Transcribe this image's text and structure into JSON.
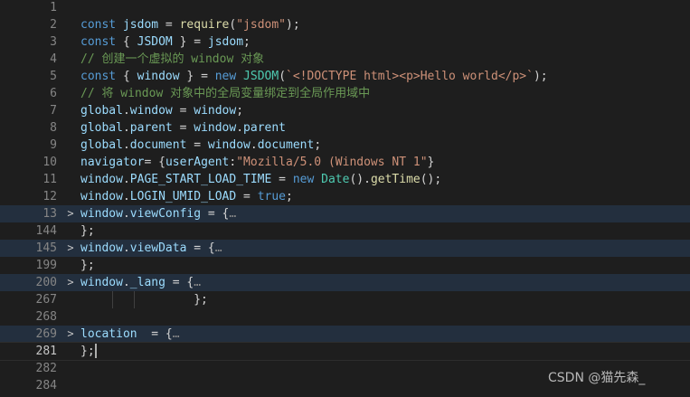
{
  "editor": {
    "lines": [
      {
        "num": "1",
        "fold": "",
        "code": []
      },
      {
        "num": "2",
        "fold": "",
        "code": [
          {
            "t": "const ",
            "c": "kw"
          },
          {
            "t": "jsdom",
            "c": "var"
          },
          {
            "t": " = ",
            "c": "op"
          },
          {
            "t": "require",
            "c": "fn"
          },
          {
            "t": "(",
            "c": "op"
          },
          {
            "t": "\"jsdom\"",
            "c": "str"
          },
          {
            "t": ");",
            "c": "op"
          }
        ]
      },
      {
        "num": "3",
        "fold": "",
        "code": [
          {
            "t": "const ",
            "c": "kw"
          },
          {
            "t": "{ ",
            "c": "op"
          },
          {
            "t": "JSDOM",
            "c": "var"
          },
          {
            "t": " } = ",
            "c": "op"
          },
          {
            "t": "jsdom",
            "c": "var"
          },
          {
            "t": ";",
            "c": "op"
          }
        ]
      },
      {
        "num": "4",
        "fold": "",
        "code": [
          {
            "t": "// 创建一个虚拟的 window 对象",
            "c": "cmt"
          }
        ]
      },
      {
        "num": "5",
        "fold": "",
        "code": [
          {
            "t": "const ",
            "c": "kw"
          },
          {
            "t": "{ ",
            "c": "op"
          },
          {
            "t": "window",
            "c": "var"
          },
          {
            "t": " } = ",
            "c": "op"
          },
          {
            "t": "new ",
            "c": "kw"
          },
          {
            "t": "JSDOM",
            "c": "cls"
          },
          {
            "t": "(",
            "c": "op"
          },
          {
            "t": "`<!DOCTYPE html><p>Hello world</p>`",
            "c": "str"
          },
          {
            "t": ");",
            "c": "op"
          }
        ]
      },
      {
        "num": "6",
        "fold": "",
        "code": [
          {
            "t": "// 将 window 对象中的全局变量绑定到全局作用域中",
            "c": "cmt"
          }
        ]
      },
      {
        "num": "7",
        "fold": "",
        "code": [
          {
            "t": "global",
            "c": "var"
          },
          {
            "t": ".",
            "c": "op"
          },
          {
            "t": "window",
            "c": "var"
          },
          {
            "t": " = ",
            "c": "op"
          },
          {
            "t": "window",
            "c": "var"
          },
          {
            "t": ";",
            "c": "op"
          }
        ]
      },
      {
        "num": "8",
        "fold": "",
        "code": [
          {
            "t": "global",
            "c": "var"
          },
          {
            "t": ".",
            "c": "op"
          },
          {
            "t": "parent",
            "c": "var"
          },
          {
            "t": " = ",
            "c": "op"
          },
          {
            "t": "window",
            "c": "var"
          },
          {
            "t": ".",
            "c": "op"
          },
          {
            "t": "parent",
            "c": "var"
          }
        ]
      },
      {
        "num": "9",
        "fold": "",
        "code": [
          {
            "t": "global",
            "c": "var"
          },
          {
            "t": ".",
            "c": "op"
          },
          {
            "t": "document",
            "c": "var"
          },
          {
            "t": " = ",
            "c": "op"
          },
          {
            "t": "window",
            "c": "var"
          },
          {
            "t": ".",
            "c": "op"
          },
          {
            "t": "document",
            "c": "var"
          },
          {
            "t": ";",
            "c": "op"
          }
        ]
      },
      {
        "num": "10",
        "fold": "",
        "code": [
          {
            "t": "navigator",
            "c": "var"
          },
          {
            "t": "= {",
            "c": "op"
          },
          {
            "t": "userAgent",
            "c": "var"
          },
          {
            "t": ":",
            "c": "op"
          },
          {
            "t": "\"Mozilla/5.0 (Windows NT 1\"",
            "c": "str"
          },
          {
            "t": "}",
            "c": "op"
          }
        ]
      },
      {
        "num": "11",
        "fold": "",
        "code": [
          {
            "t": "window",
            "c": "var"
          },
          {
            "t": ".",
            "c": "op"
          },
          {
            "t": "PAGE_START_LOAD_TIME",
            "c": "var"
          },
          {
            "t": " = ",
            "c": "op"
          },
          {
            "t": "new ",
            "c": "kw"
          },
          {
            "t": "Date",
            "c": "cls"
          },
          {
            "t": "().",
            "c": "op"
          },
          {
            "t": "getTime",
            "c": "fn"
          },
          {
            "t": "();",
            "c": "op"
          }
        ]
      },
      {
        "num": "12",
        "fold": "",
        "code": [
          {
            "t": "window",
            "c": "var"
          },
          {
            "t": ".",
            "c": "op"
          },
          {
            "t": "LOGIN_UMID_LOAD",
            "c": "var"
          },
          {
            "t": " = ",
            "c": "op"
          },
          {
            "t": "true",
            "c": "kw"
          },
          {
            "t": ";",
            "c": "op"
          }
        ]
      },
      {
        "num": "13",
        "fold": ">",
        "folded": true,
        "code": [
          {
            "t": "window",
            "c": "var"
          },
          {
            "t": ".",
            "c": "op"
          },
          {
            "t": "viewConfig",
            "c": "var"
          },
          {
            "t": " = {",
            "c": "op"
          },
          {
            "t": "…",
            "c": "ellipsis"
          }
        ]
      },
      {
        "num": "144",
        "fold": "",
        "code": [
          {
            "t": "};",
            "c": "op"
          }
        ]
      },
      {
        "num": "145",
        "fold": ">",
        "folded": true,
        "code": [
          {
            "t": "window",
            "c": "var"
          },
          {
            "t": ".",
            "c": "op"
          },
          {
            "t": "viewData",
            "c": "var"
          },
          {
            "t": " = {",
            "c": "op"
          },
          {
            "t": "…",
            "c": "ellipsis"
          }
        ]
      },
      {
        "num": "199",
        "fold": "",
        "code": [
          {
            "t": "};",
            "c": "op"
          }
        ]
      },
      {
        "num": "200",
        "fold": ">",
        "folded": true,
        "code": [
          {
            "t": "window",
            "c": "var"
          },
          {
            "t": ".",
            "c": "op"
          },
          {
            "t": "_lang",
            "c": "var"
          },
          {
            "t": " = {",
            "c": "op"
          },
          {
            "t": "…",
            "c": "ellipsis"
          }
        ]
      },
      {
        "num": "267",
        "fold": "",
        "guides": true,
        "code": [
          {
            "t": "                };",
            "c": "op"
          }
        ]
      },
      {
        "num": "268",
        "fold": "",
        "code": []
      },
      {
        "num": "269",
        "fold": ">",
        "folded": true,
        "code": [
          {
            "t": "location",
            "c": "var"
          },
          {
            "t": "  = {",
            "c": "op"
          },
          {
            "t": "…",
            "c": "ellipsis"
          }
        ]
      },
      {
        "num": "281",
        "fold": "",
        "current": true,
        "cursor": true,
        "code": [
          {
            "t": "};",
            "c": "op"
          }
        ]
      },
      {
        "num": "282",
        "fold": "",
        "code": []
      },
      {
        "num": "284",
        "fold": "",
        "code": []
      }
    ]
  },
  "colors": {
    "background": "#1e1e1e",
    "keyword": "#569cd6",
    "variable": "#9cdcfe",
    "function": "#dcdcaa",
    "string": "#ce9178",
    "class": "#4ec9b0",
    "comment": "#6a9955",
    "folded_line": "#232f3e"
  },
  "watermark": "CSDN @猫先森_"
}
